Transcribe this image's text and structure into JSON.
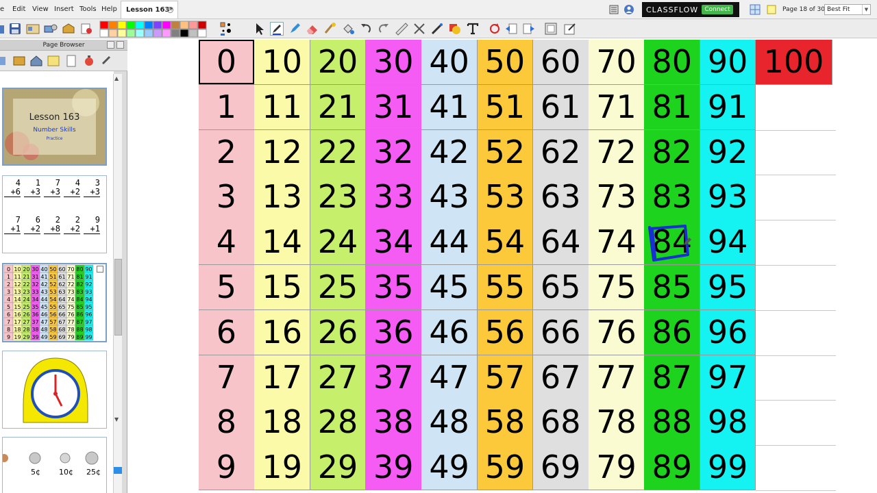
{
  "menu": [
    "e",
    "Edit",
    "View",
    "Insert",
    "Tools",
    "Help"
  ],
  "document_tab": {
    "title": "Lesson 163*"
  },
  "classflow": {
    "logo": "CLASSFLOW",
    "connect": "Connect"
  },
  "page_indicator": "Page 18 of 30",
  "zoom": "Best Fit",
  "palette_colors": [
    "#ff0000",
    "#ff8000",
    "#ffff00",
    "#00ff00",
    "#00ffff",
    "#0080ff",
    "#8040ff",
    "#ff00ff",
    "#c08040",
    "#ffc080",
    "#ff9999",
    "#cc0000",
    "#ffffff",
    "#ffd0a0",
    "#ffff99",
    "#99ff99",
    "#99ffff",
    "#99ccff",
    "#cc99ff",
    "#ff99ff",
    "#808080",
    "#000000",
    "#c0c0c0",
    "#ffffff"
  ],
  "page_browser": {
    "title": "Page Browser",
    "thumbnails": [
      {
        "title": "Lesson 163",
        "subtitle": "Number Skills",
        "caption": "Practice"
      },
      {
        "flashcards_row1": [
          "4+6",
          "1+3",
          "7+3",
          "4+2",
          "3+3"
        ],
        "flashcards_row2": [
          "7+1",
          "6+2",
          "2+8",
          "2+2",
          "9+1"
        ]
      },
      {
        "type": "hundred-chart-mini"
      },
      {
        "type": "clock"
      },
      {
        "coins": [
          "5¢",
          "10¢",
          "25¢"
        ]
      }
    ]
  },
  "chart": {
    "columns": [
      {
        "color": "#f7c4c9",
        "values": [
          "0",
          "1",
          "2",
          "3",
          "4",
          "5",
          "6",
          "7",
          "8",
          "9"
        ]
      },
      {
        "color": "#fafaa8",
        "values": [
          "10",
          "11",
          "12",
          "13",
          "14",
          "15",
          "16",
          "17",
          "18",
          "19"
        ]
      },
      {
        "color": "#c6ef6c",
        "values": [
          "20",
          "21",
          "22",
          "23",
          "24",
          "25",
          "26",
          "27",
          "28",
          "29"
        ]
      },
      {
        "color": "#f45cf4",
        "values": [
          "30",
          "31",
          "32",
          "33",
          "34",
          "35",
          "36",
          "37",
          "38",
          "39"
        ]
      },
      {
        "color": "#cfe5f5",
        "values": [
          "40",
          "41",
          "42",
          "43",
          "44",
          "45",
          "46",
          "47",
          "48",
          "49"
        ]
      },
      {
        "color": "#fbc93a",
        "values": [
          "50",
          "51",
          "52",
          "53",
          "54",
          "55",
          "56",
          "57",
          "58",
          "59"
        ]
      },
      {
        "color": "#dfdfdf",
        "values": [
          "60",
          "61",
          "62",
          "63",
          "64",
          "65",
          "66",
          "67",
          "68",
          "69"
        ]
      },
      {
        "color": "#fbfbd2",
        "values": [
          "70",
          "71",
          "72",
          "73",
          "74",
          "75",
          "76",
          "77",
          "78",
          "79"
        ]
      },
      {
        "color": "#1ed31e",
        "values": [
          "80",
          "81",
          "82",
          "83",
          "84",
          "85",
          "86",
          "87",
          "88",
          "89"
        ]
      },
      {
        "color": "#14f2f2",
        "values": [
          "90",
          "91",
          "92",
          "93",
          "94",
          "95",
          "96",
          "97",
          "98",
          "99"
        ]
      }
    ],
    "extra_cell": {
      "value": "100",
      "color": "#e8252c"
    },
    "annotation_color": "#1830d0"
  }
}
